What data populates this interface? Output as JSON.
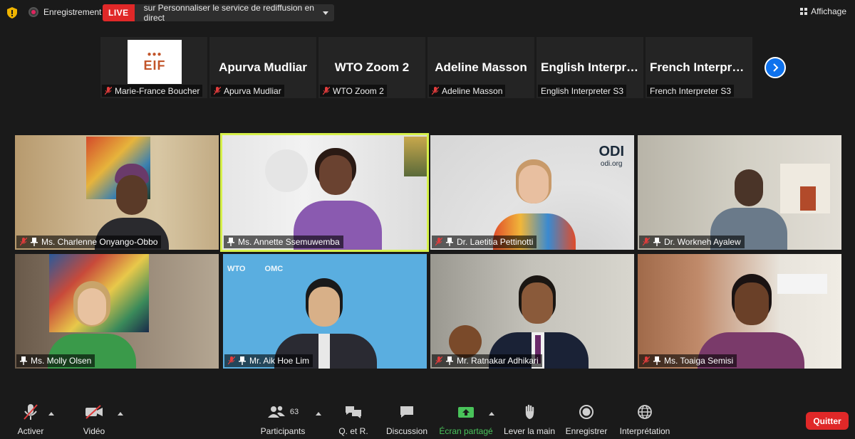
{
  "topbar": {
    "recording_label": "Enregistrement",
    "live_badge": "LIVE",
    "live_text": "sur Personnaliser le service de rediffusion en direct",
    "view_label": "Affichage"
  },
  "thumbnails": [
    {
      "name": "",
      "label": "Marie-France Boucher",
      "muted": true,
      "logo": "EIF"
    },
    {
      "name": "Apurva Mudliar",
      "label": "Apurva Mudliar",
      "muted": true
    },
    {
      "name": "WTO Zoom 2",
      "label": "WTO Zoom 2",
      "muted": true
    },
    {
      "name": "Adeline Masson",
      "label": "Adeline Masson",
      "muted": true
    },
    {
      "name": "English  Interpre...",
      "label": "English Interpreter S3",
      "muted": false
    },
    {
      "name": "French  Interpre...",
      "label": "French Interpreter S3",
      "muted": false
    }
  ],
  "eif_logo": {
    "mark": "EIF",
    "dots": "●●●"
  },
  "participants": [
    {
      "name": "Ms. Charlenne Onyango-Obbo",
      "muted": true
    },
    {
      "name": "Ms. Annette Ssemuwemba",
      "muted": false,
      "active": true
    },
    {
      "name": "Dr. Laetitia Pettinotti",
      "muted": true
    },
    {
      "name": "Dr. Workneh Ayalew",
      "muted": true
    },
    {
      "name": "Ms. Molly Olsen",
      "muted": false
    },
    {
      "name": "Mr. Aik Hoe Lim",
      "muted": true
    },
    {
      "name": "Mr. Ratnakar Adhikari",
      "muted": true
    },
    {
      "name": "Ms. Toaiga Semisi",
      "muted": true
    }
  ],
  "odi": {
    "logo": "ODI",
    "url": "odi.org"
  },
  "wto_wall": {
    "wto": "WTO",
    "omc": "OMC"
  },
  "toolbar": {
    "mute": "Activer",
    "video": "Vidéo",
    "participants": "Participants",
    "participants_count": "63",
    "qa": "Q. et R.",
    "chat": "Discussion",
    "share": "Écran partagé",
    "raise_hand": "Lever la main",
    "record": "Enregistrer",
    "interpretation": "Interprétation",
    "quit": "Quitter"
  },
  "colors": {
    "live": "#e02828",
    "active_speaker": "#d6f04a",
    "share_green": "#49c35a",
    "next_blue": "#0e72ed"
  }
}
